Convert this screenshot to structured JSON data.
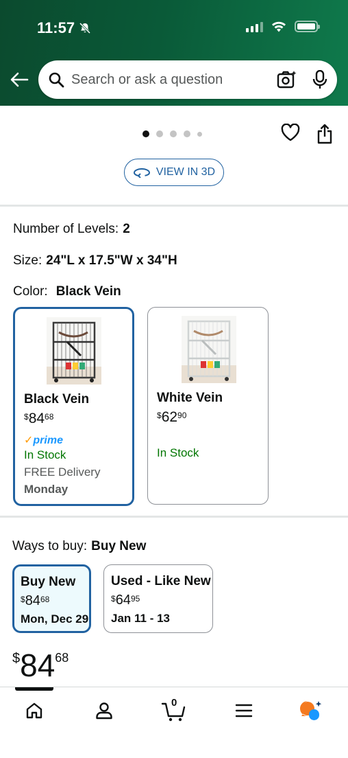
{
  "status_bar": {
    "time": "11:57"
  },
  "search": {
    "placeholder": "Search or ask a question"
  },
  "view_3d": {
    "label": "VIEW IN 3D"
  },
  "options": {
    "levels_label": "Number of Levels:",
    "levels_value": "2",
    "size_label": "Size:",
    "size_value": "24\"L x 17.5\"W x 34\"H",
    "color_label": "Color:",
    "color_value": "Black Vein"
  },
  "variants": [
    {
      "name": "Black Vein",
      "currency": "$",
      "price_whole": "84",
      "price_fraction": "68",
      "prime": "prime",
      "stock": "In Stock",
      "delivery": "FREE Delivery",
      "delivery_day": "Monday",
      "selected": true
    },
    {
      "name": "White Vein",
      "currency": "$",
      "price_whole": "62",
      "price_fraction": "90",
      "stock": "In Stock",
      "selected": false
    }
  ],
  "ways_to_buy": {
    "label": "Ways to buy:",
    "value": "Buy New",
    "options": [
      {
        "title": "Buy New",
        "currency": "$",
        "price_whole": "84",
        "price_fraction": "68",
        "date": "Mon, Dec 29",
        "selected": true
      },
      {
        "title": "Used - Like New",
        "currency": "$",
        "price_whole": "64",
        "price_fraction": "95",
        "date": "Jan 11 - 13",
        "selected": false
      }
    ]
  },
  "price": {
    "currency": "$",
    "whole": "84",
    "fraction": "68"
  },
  "tabbar": {
    "cart_count": "0"
  },
  "colors": {
    "header_green": "#0a5a38",
    "accent_blue": "#2162a1",
    "in_stock_green": "#007600",
    "prime_blue": "#1a98ff"
  }
}
